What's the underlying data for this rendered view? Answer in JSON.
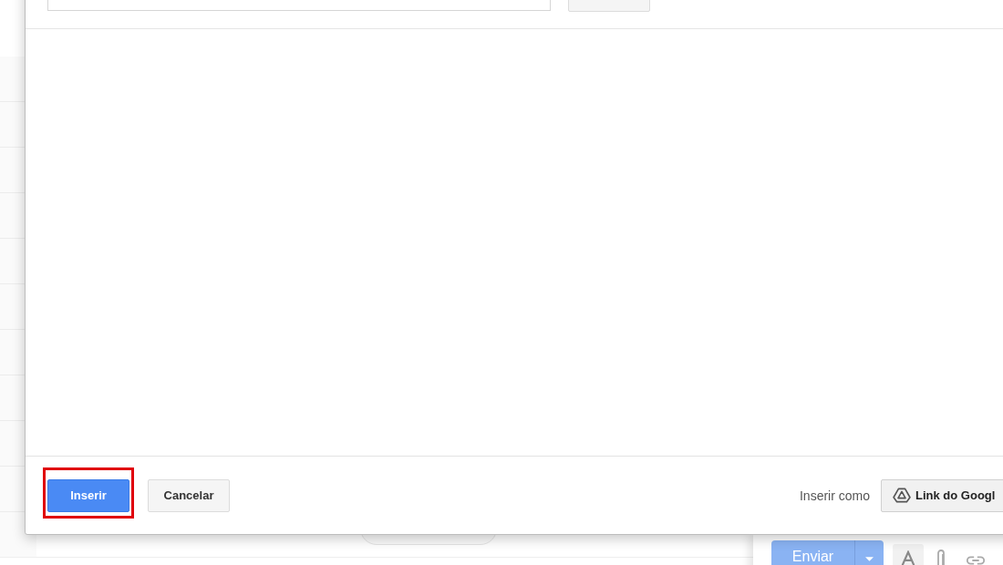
{
  "dialog": {
    "footer": {
      "buttons": [
        {
          "label": "Inserir",
          "kind": "primary",
          "highlighted": true
        },
        {
          "label": "Cancelar",
          "kind": "secondary",
          "highlighted": false
        }
      ],
      "insert_as_label": "Inserir como",
      "insert_as_option": "Link do Googl"
    }
  },
  "compose": {
    "send_button": "Enviar"
  }
}
